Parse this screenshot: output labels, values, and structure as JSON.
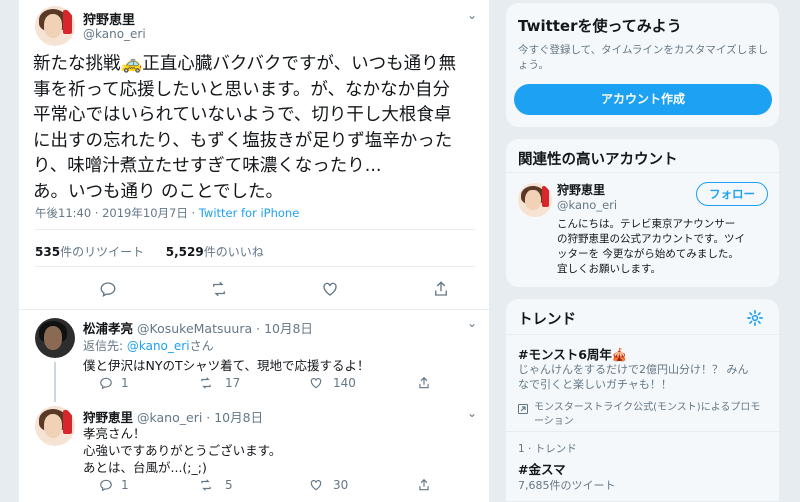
{
  "tweet": {
    "author_name": "狩野恵里",
    "author_handle": "@kano_eri",
    "menu_icon": "chevron-down-icon",
    "text_lines": [
      "新たな挑戦🚕正直心臓バクバクですが、いつも通り無",
      "事を祈って応援したいと思います。が、なかなか自分",
      "平常心ではいられていないようで、切り干し大根食卓",
      "に出すの忘れたり、もずく塩抜きが足りず塩辛かった",
      "り、味噌汁煮立たせすぎて味濃くなったり...",
      "あ。いつも通り のことでした。"
    ],
    "timestamp": "午後11:40 · 2019年10月7日 · ",
    "source": "Twitter for iPhone",
    "retweets_count": "535",
    "retweets_label": "件のリツイート",
    "likes_count": "5,529",
    "likes_label": "件のいいね"
  },
  "replies": [
    {
      "author_name": "松浦孝亮",
      "author_handle": "@KosukeMatsuura",
      "date": " · 10月8日",
      "reply_to_prefix": "返信先: ",
      "reply_to_handle": "@kano_eri",
      "reply_to_suffix": "さん",
      "text_lines": [
        "僕と伊沢はNYのTシャツ着て、現地で応援するよ！"
      ],
      "reply_count": "1",
      "retweet_count": "17",
      "like_count": "140"
    },
    {
      "author_name": "狩野恵里",
      "author_handle": "@kano_eri",
      "date": " · 10月8日",
      "text_lines": [
        "孝亮さん！",
        "心強いですありがとうございます。",
        "あとは、台風が...(;_;)"
      ],
      "reply_count": "1",
      "retweet_count": "5",
      "like_count": "30"
    }
  ],
  "sidebar": {
    "signup": {
      "title": "Twitterを使ってみよう",
      "description": "今すぐ登録して、タイムラインをカスタマイズしましょう。",
      "button_label": "アカウント作成"
    },
    "related": {
      "title": "関連性の高いアカウント",
      "name": "狩野恵里",
      "handle": "@kano_eri",
      "follow_label": "フォロー",
      "bio_lines": [
        "こんにちは。テレビ東京アナウンサー",
        "の狩野恵里の公式アカウントです。ツイ",
        "ッターを 今更ながら始めてみました。",
        "宜しくお願いします。"
      ]
    },
    "trends": {
      "title": "トレンド",
      "settings_icon": "gear-icon",
      "items": [
        {
          "name": "#モンスト6周年🎪",
          "desc_lines": [
            "じゃんけんをするだけで2億円山分け！？ みん",
            "なで引くと楽しいガチャも！！"
          ],
          "promo_lines": [
            "モンスターストライク公式(モンスト)によるプロモ",
            "ーション"
          ]
        },
        {
          "meta": "1 · トレンド",
          "name": "#金スマ",
          "count": "7,685件のツイート"
        }
      ]
    }
  },
  "colors": {
    "accent": "#1da1f2",
    "background": "#e6ecf0",
    "text": "#14171a",
    "muted": "#657786"
  }
}
